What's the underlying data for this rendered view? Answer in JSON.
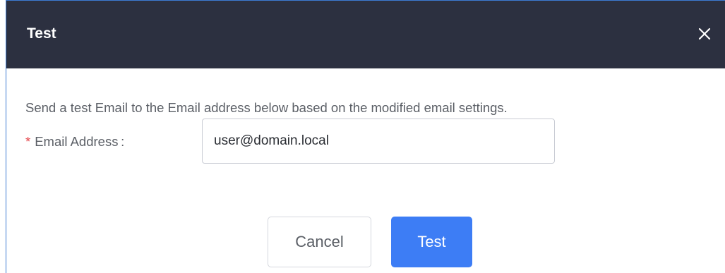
{
  "dialog": {
    "title": "Test",
    "close_icon": "close-icon"
  },
  "body": {
    "description": "Send a test Email to the Email address below based on the modified email settings.",
    "email_field": {
      "required_marker": "*",
      "label": "Email Address :",
      "value": "user@domain.local"
    }
  },
  "footer": {
    "cancel_label": "Cancel",
    "test_label": "Test"
  },
  "colors": {
    "header_bg": "#2c3040",
    "primary": "#3d7df5",
    "required": "#e5484d"
  }
}
